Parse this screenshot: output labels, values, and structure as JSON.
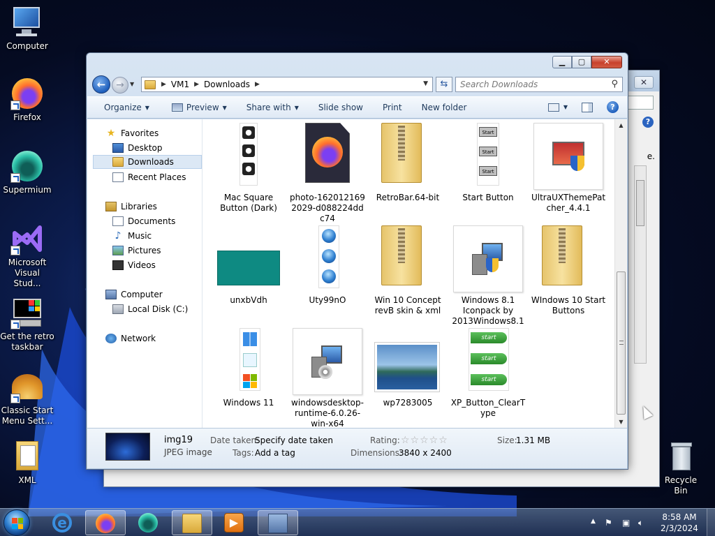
{
  "desktop": {
    "icons": [
      {
        "label": "Computer",
        "icon": "computer-icon"
      },
      {
        "label": "Firefox",
        "icon": "firefox-icon"
      },
      {
        "label": "Supermium",
        "icon": "supermium-icon"
      },
      {
        "label": "Microsoft Visual Stud...",
        "icon": "visual-studio-icon"
      },
      {
        "label": "Get the retro taskbar",
        "icon": "retro-taskbar-icon"
      },
      {
        "label": "Classic Start Menu Sett...",
        "icon": "classic-start-icon"
      },
      {
        "label": "XML",
        "icon": "xml-file-icon"
      }
    ],
    "recycle_bin": "Recycle Bin"
  },
  "background_window": {
    "partial_text": "e."
  },
  "explorer": {
    "caption_buttons": {
      "minimize": "▁",
      "maximize": "▢",
      "close": "✕"
    },
    "address": {
      "crumbs": [
        "VM1",
        "Downloads"
      ]
    },
    "search_placeholder": "Search Downloads",
    "toolbar": {
      "organize": "Organize",
      "preview": "Preview",
      "share_with": "Share with",
      "slide_show": "Slide show",
      "print": "Print",
      "new_folder": "New folder"
    },
    "nav": {
      "favorites": "Favorites",
      "desktop": "Desktop",
      "downloads": "Downloads",
      "recent_places": "Recent Places",
      "libraries": "Libraries",
      "documents": "Documents",
      "music": "Music",
      "pictures": "Pictures",
      "videos": "Videos",
      "computer": "Computer",
      "local_disk": "Local Disk (C:)",
      "network": "Network"
    },
    "files": [
      {
        "name": "Mac Square Button (Dark)",
        "kind": "apple-strip"
      },
      {
        "name": "photo-1620121692029-d088224ddc74",
        "kind": "firefox-doc"
      },
      {
        "name": "RetroBar.64-bit",
        "kind": "zip-folder"
      },
      {
        "name": "Start Button",
        "kind": "start-strip"
      },
      {
        "name": "UltraUXThemePatcher_4.4.1",
        "kind": "installer"
      },
      {
        "name": "unxbVdh",
        "kind": "teal-image"
      },
      {
        "name": "Uty99nO",
        "kind": "orb-strip"
      },
      {
        "name": "Win 10 Concept revB skin & xml",
        "kind": "zip-folder"
      },
      {
        "name": "Windows 8.1 Iconpack by 2013Windows8.1",
        "kind": "installer"
      },
      {
        "name": "WIndows 10 Start Buttons",
        "kind": "zip-folder"
      },
      {
        "name": "Windows 11",
        "kind": "win11-strip"
      },
      {
        "name": "windowsdesktop-runtime-6.0.26-win-x64",
        "kind": "installer"
      },
      {
        "name": "wp7283005",
        "kind": "landscape"
      },
      {
        "name": "XP_Button_ClearType",
        "kind": "xp-strip"
      }
    ],
    "details": {
      "name": "img19",
      "type": "JPEG image",
      "date_taken_label": "Date taken:",
      "date_taken_value": "Specify date taken",
      "tags_label": "Tags:",
      "tags_value": "Add a tag",
      "rating_label": "Rating:",
      "rating_stars": "☆☆☆☆☆",
      "dimensions_label": "Dimensions:",
      "dimensions_value": "3840 x 2400",
      "size_label": "Size:",
      "size_value": "1.31 MB"
    }
  },
  "taskbar": {
    "time": "8:58 AM",
    "date": "2/3/2024"
  }
}
